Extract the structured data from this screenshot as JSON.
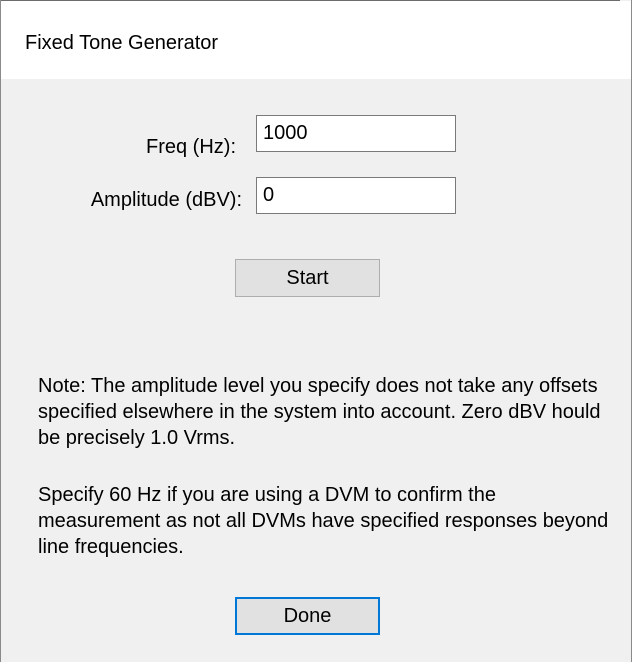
{
  "window": {
    "title": "Fixed Tone Generator"
  },
  "form": {
    "freq_label": "Freq (Hz):",
    "freq_value": "1000",
    "amplitude_label": "Amplitude (dBV):",
    "amplitude_value": "0"
  },
  "buttons": {
    "start_label": "Start",
    "done_label": "Done"
  },
  "notes": {
    "note_1": "Note: The amplitude level you specify does not take any offsets specified elsewhere in the system into account. Zero dBV hould be precisely 1.0 Vrms.",
    "note_2": "Specify 60 Hz if you are using a DVM to confirm the measurement as not all DVMs have specified responses beyond line frequencies."
  },
  "colors": {
    "dialog_background": "#f0f0f0",
    "titlebar_background": "#ffffff",
    "button_face": "#e1e1e1",
    "default_button_border": "#0078d7"
  }
}
